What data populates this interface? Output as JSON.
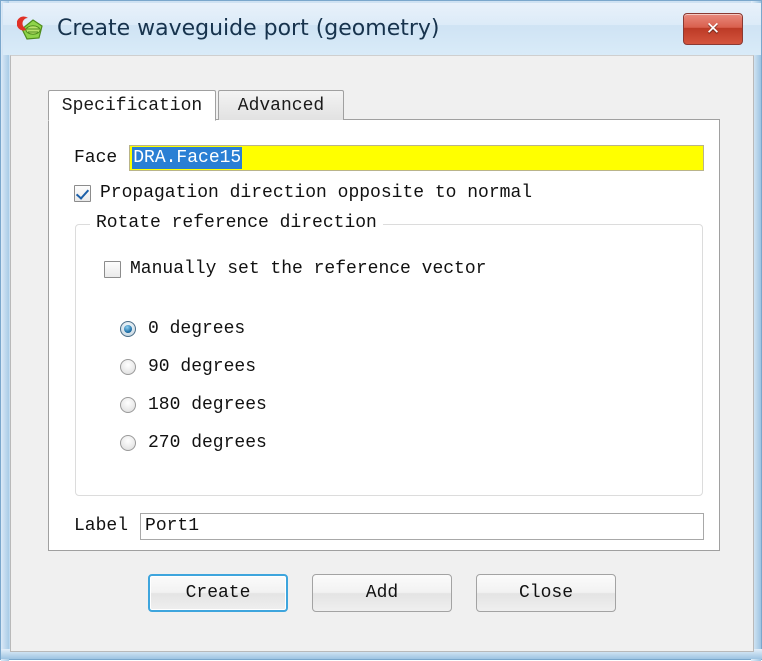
{
  "window": {
    "title": "Create waveguide port (geometry)",
    "icon": "cst-app-icon",
    "close_label": "✕"
  },
  "tabs": [
    {
      "label": "Specification",
      "active": true
    },
    {
      "label": "Advanced",
      "active": false
    }
  ],
  "form": {
    "face": {
      "label": "Face",
      "value": "DRA.Face15",
      "selected": true,
      "highlight_color": "#ffff00",
      "selection_color": "#2a7fd4"
    },
    "propagation": {
      "label": "Propagation direction opposite to normal",
      "checked": true
    },
    "group": {
      "title": "Rotate reference direction",
      "manual_vector": {
        "label": "Manually set the reference vector",
        "checked": false
      },
      "rotation_options": [
        {
          "label": "0 degrees",
          "selected": true
        },
        {
          "label": "90 degrees",
          "selected": false
        },
        {
          "label": "180 degrees",
          "selected": false
        },
        {
          "label": "270 degrees",
          "selected": false
        }
      ]
    },
    "port_label": {
      "label": "Label",
      "value": "Port1"
    }
  },
  "buttons": [
    {
      "label": "Create",
      "default": true
    },
    {
      "label": "Add",
      "default": false
    },
    {
      "label": "Close",
      "default": false
    }
  ]
}
